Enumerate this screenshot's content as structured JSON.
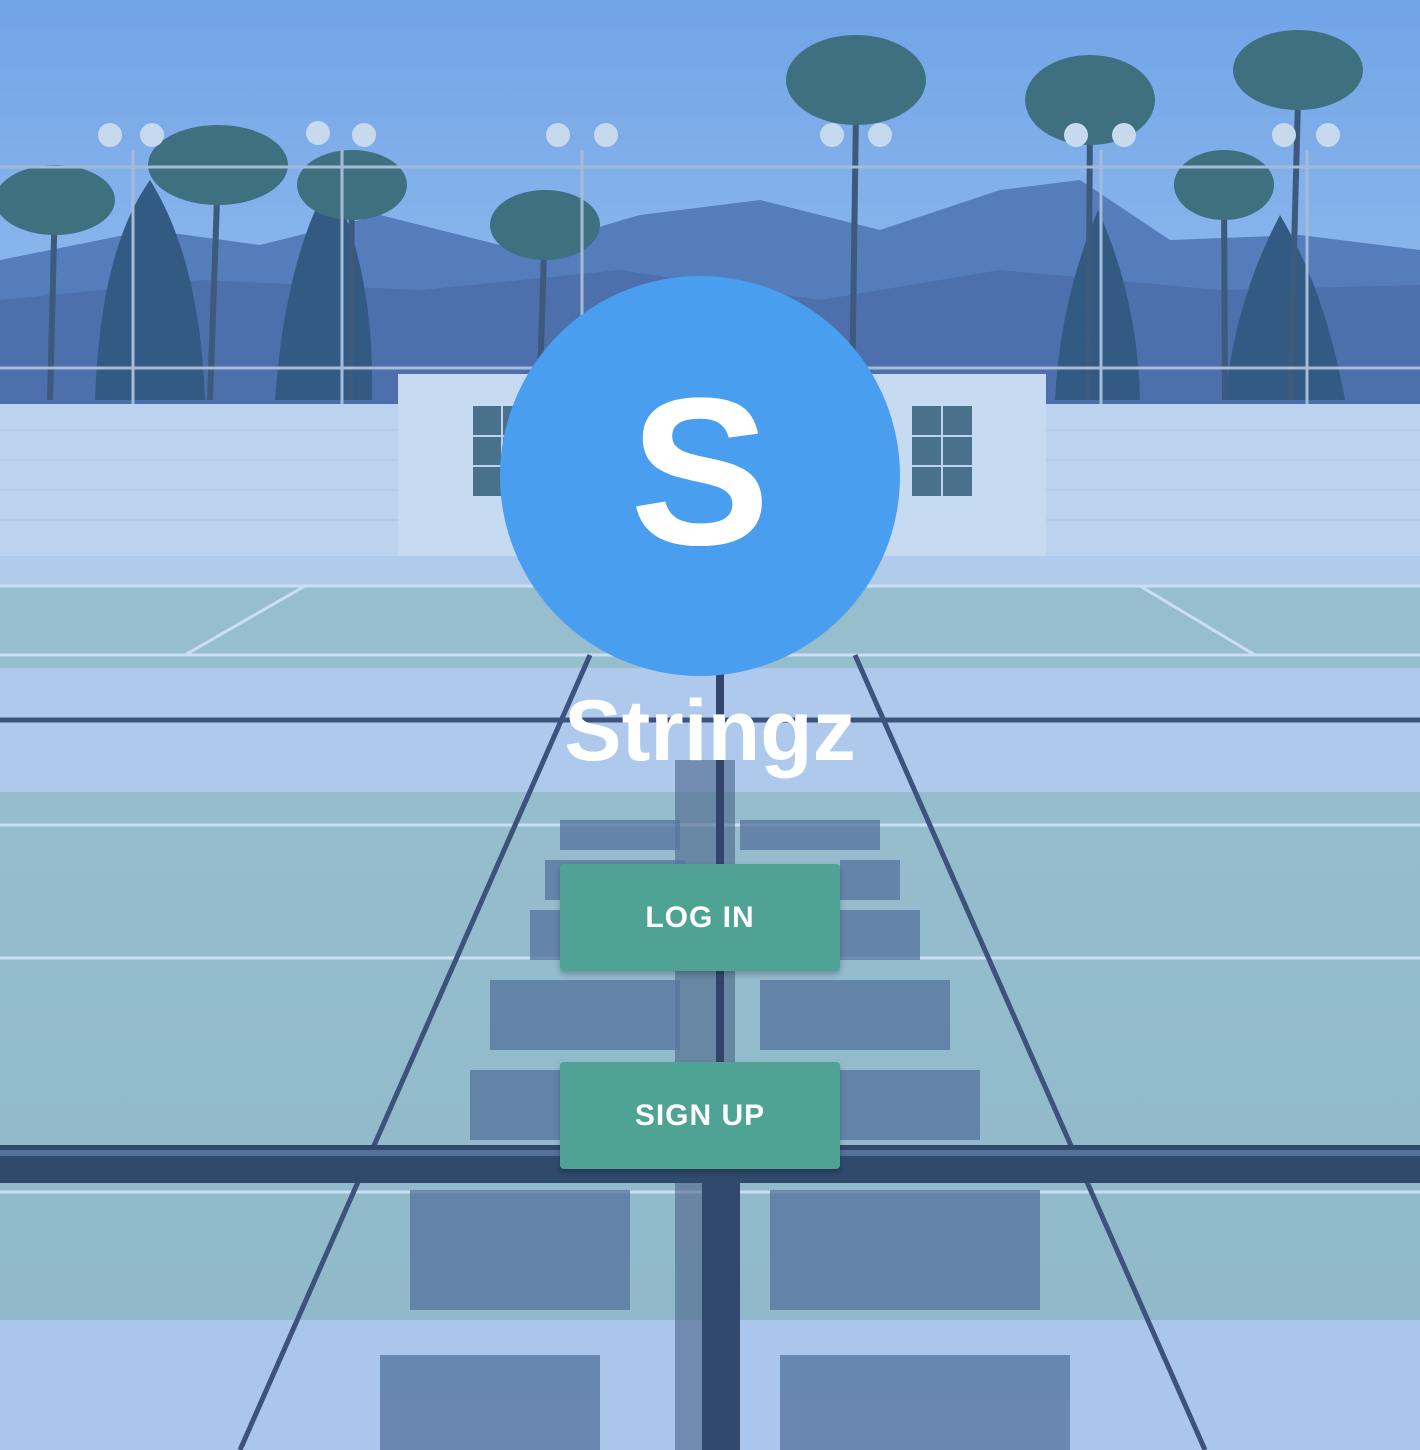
{
  "colors": {
    "logo_circle": "#4a9ef0",
    "button": "#4fa394",
    "text": "#ffffff"
  },
  "background": {
    "description_icon": "tennis-court-photo"
  },
  "logo": {
    "letter": "S"
  },
  "app": {
    "title": "Stringz"
  },
  "buttons": {
    "login_label": "LOG IN",
    "signup_label": "SIGN UP"
  }
}
